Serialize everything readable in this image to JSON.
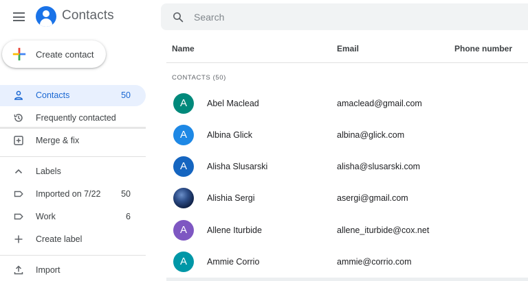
{
  "header": {
    "app_title": "Contacts",
    "search_placeholder": "Search"
  },
  "sidebar": {
    "create_label": "Create contact",
    "items": [
      {
        "label": "Contacts",
        "count": "50",
        "icon": "person-icon",
        "active": true
      },
      {
        "label": "Frequently contacted",
        "count": "",
        "icon": "history-icon"
      },
      {
        "label": "Merge & fix",
        "count": "",
        "icon": "merge-icon"
      },
      {
        "label": "Labels",
        "count": "",
        "icon": "chevron-up-icon"
      },
      {
        "label": "Imported on 7/22",
        "count": "50",
        "icon": "label-icon"
      },
      {
        "label": "Work",
        "count": "6",
        "icon": "label-icon"
      },
      {
        "label": "Create label",
        "count": "",
        "icon": "plus-icon"
      },
      {
        "label": "Import",
        "count": "",
        "icon": "upload-icon"
      }
    ]
  },
  "table": {
    "columns": [
      "Name",
      "Email",
      "Phone number"
    ],
    "section_label": "CONTACTS (50)",
    "rows": [
      {
        "initial": "A",
        "name": "Abel Maclead",
        "email": "amaclead@gmail.com",
        "color": "#00897b"
      },
      {
        "initial": "A",
        "name": "Albina Glick",
        "email": "albina@glick.com",
        "color": "#1e88e5"
      },
      {
        "initial": "A",
        "name": "Alisha Slusarski",
        "email": "alisha@slusarski.com",
        "color": "#1565c0"
      },
      {
        "initial": "",
        "name": "Alishia Sergi",
        "email": "asergi@gmail.com",
        "color": "#0e1f44"
      },
      {
        "initial": "A",
        "name": "Allene Iturbide",
        "email": "allene_iturbide@cox.net",
        "color": "#7e57c2"
      },
      {
        "initial": "A",
        "name": "Ammie Corrio",
        "email": "ammie@corrio.com",
        "color": "#0097a7"
      }
    ]
  },
  "colors": {
    "accent": "#1a73e8",
    "active_bg": "#e8f0fe",
    "active_text": "#1967d2"
  }
}
